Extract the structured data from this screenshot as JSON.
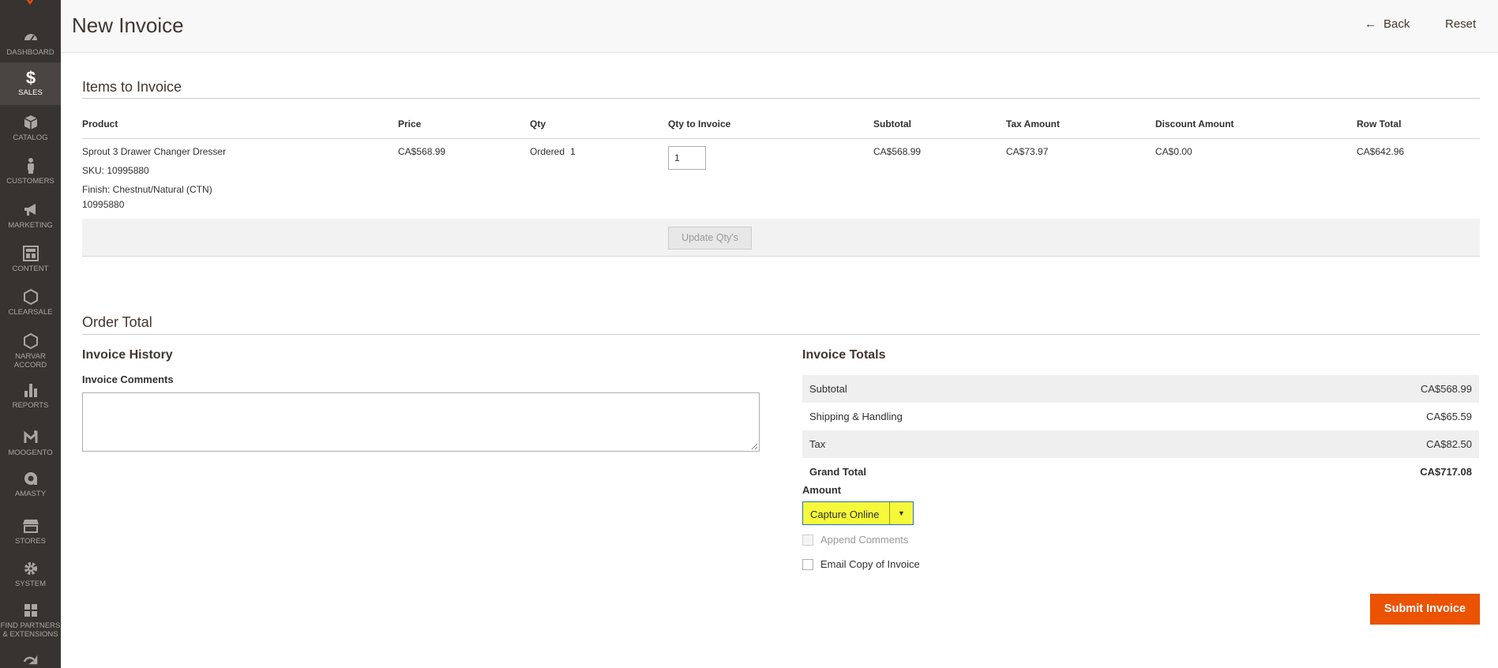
{
  "colors": {
    "sidebar_bg": "#373330",
    "accent_orange": "#eb5202",
    "highlight_yellow": "#f5f93a"
  },
  "sidebar": {
    "items": [
      {
        "label": "DASHBOARD",
        "icon": "dashboard-icon"
      },
      {
        "label": "SALES",
        "icon": "dollar-icon",
        "active": true
      },
      {
        "label": "CATALOG",
        "icon": "cube-icon"
      },
      {
        "label": "CUSTOMERS",
        "icon": "person-icon"
      },
      {
        "label": "MARKETING",
        "icon": "megaphone-icon"
      },
      {
        "label": "CONTENT",
        "icon": "layout-icon"
      },
      {
        "label": "CLEARSALE",
        "icon": "hexagon-icon"
      },
      {
        "label_line1": "NARVAR",
        "label_line2": "ACCORD",
        "icon": "hexagon-icon"
      },
      {
        "label": "REPORTS",
        "icon": "bar-chart-icon"
      },
      {
        "label": "MOOGENTO",
        "icon": "moogento-icon"
      },
      {
        "label": "AMASTY",
        "icon": "amasty-icon"
      },
      {
        "label": "STORES",
        "icon": "store-icon"
      },
      {
        "label": "SYSTEM",
        "icon": "gear-icon"
      },
      {
        "label_line1": "FIND PARTNERS",
        "label_line2": "& EXTENSIONS",
        "icon": "boxes-icon"
      }
    ]
  },
  "header": {
    "title": "New Invoice",
    "back_label": "Back",
    "reset_label": "Reset"
  },
  "items_section": {
    "title": "Items to Invoice",
    "columns": [
      "Product",
      "Price",
      "Qty",
      "Qty to Invoice",
      "Subtotal",
      "Tax Amount",
      "Discount Amount",
      "Row Total"
    ],
    "row": {
      "product_name": "Sprout 3 Drawer Changer Dresser",
      "sku": "SKU: 10995880",
      "option": "Finish: Chestnut/Natural (CTN)",
      "option_code": "10995880",
      "price": "CA$568.99",
      "qty_label": "Ordered",
      "qty_value": "1",
      "qty_to_invoice": "1",
      "subtotal": "CA$568.99",
      "tax_amount": "CA$73.97",
      "discount_amount": "CA$0.00",
      "row_total": "CA$642.96"
    },
    "update_button": "Update Qty's"
  },
  "order_total": {
    "title": "Order Total",
    "history": {
      "title": "Invoice History",
      "comments_label": "Invoice Comments",
      "comments_value": ""
    },
    "totals": {
      "title": "Invoice Totals",
      "rows": [
        {
          "label": "Subtotal",
          "value": "CA$568.99"
        },
        {
          "label": "Shipping & Handling",
          "value": "CA$65.59"
        },
        {
          "label": "Tax",
          "value": "CA$82.50"
        },
        {
          "label": "Grand Total",
          "value": "CA$717.08"
        }
      ],
      "amount_label": "Amount",
      "amount_selected": "Capture Online",
      "append_comments": "Append Comments",
      "email_copy": "Email Copy of Invoice"
    },
    "submit_button": "Submit Invoice"
  }
}
